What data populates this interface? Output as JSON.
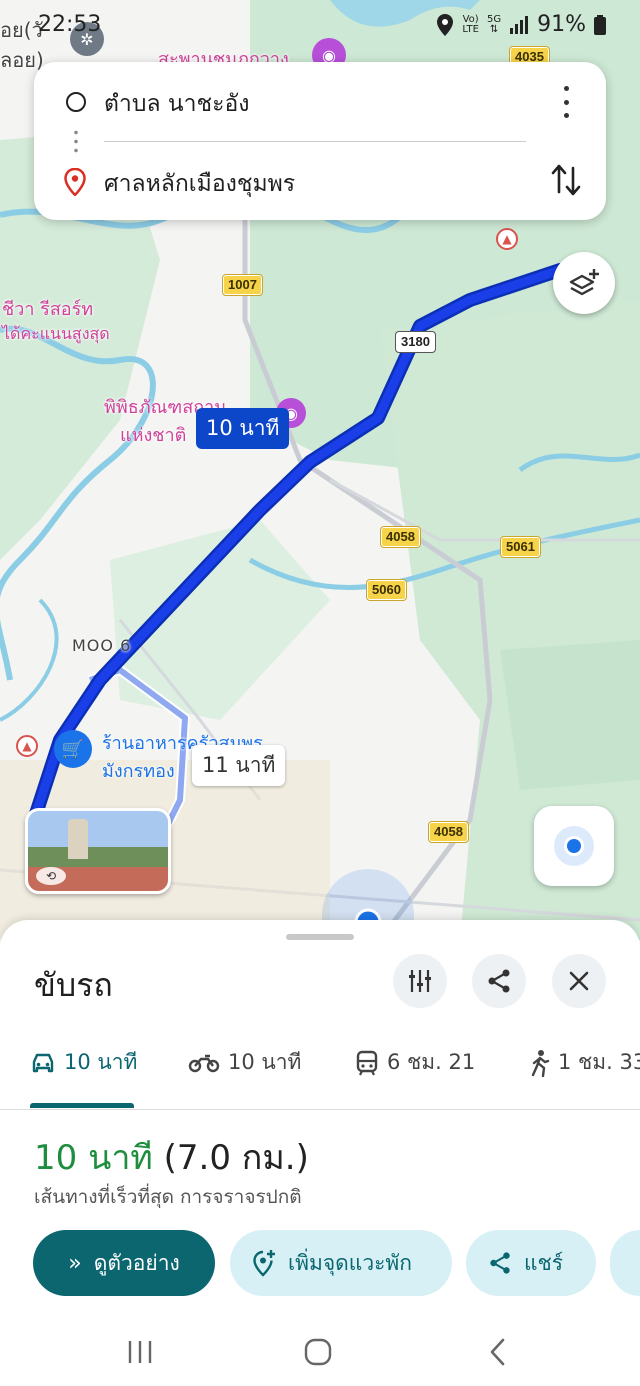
{
  "status_bar": {
    "time": "22:53",
    "battery": "91%"
  },
  "route_card": {
    "origin": "ตำบล นาชะอัง",
    "destination": "ศาลหลักเมืองชุมพร"
  },
  "map": {
    "shields": [
      "4035",
      "1007",
      "3180",
      "4058",
      "5061",
      "5060",
      "4058"
    ],
    "labels": {
      "label_top_left_1": "อย(วั",
      "label_top_left_2": "ลอย)",
      "label_top": "สะพานชมภูกวาง",
      "resort_1": "ชีวา รีสอร์ท",
      "resort_2": "ได้คะแนนสูงสุด",
      "museum_1": "พิพิธภัณฑสถาน",
      "museum_2": "แห่งชาติ",
      "moo": "MOO 6",
      "restaurant_1": "ร้านอาหารครัวสมพร",
      "restaurant_2": "มังกรทอง"
    },
    "eta_primary": "10 นาที",
    "eta_alt": "11 นาที"
  },
  "sheet": {
    "title": "ขับรถ",
    "tabs": [
      {
        "icon": "car-icon",
        "label": "10 นาที"
      },
      {
        "icon": "motorcycle-icon",
        "label": "10 นาที"
      },
      {
        "icon": "transit-icon",
        "label": "6 ชม. 21"
      },
      {
        "icon": "walk-icon",
        "label": "1 ชม. 33"
      }
    ],
    "summary_time": "10 นาที",
    "summary_distance": "(7.0 กม.)",
    "summary_note": "เส้นทางที่เร็วที่สุด การจราจรปกติ",
    "buttons": {
      "preview": "ดูตัวอย่าง",
      "add_stop": "เพิ่มจุดแวะพัก",
      "share": "แชร์"
    }
  },
  "colors": {
    "route_primary": "#1a3ee8",
    "route_alt": "#8fa8f0",
    "accent": "#0b6670",
    "duration_green": "#1e8e3e"
  }
}
